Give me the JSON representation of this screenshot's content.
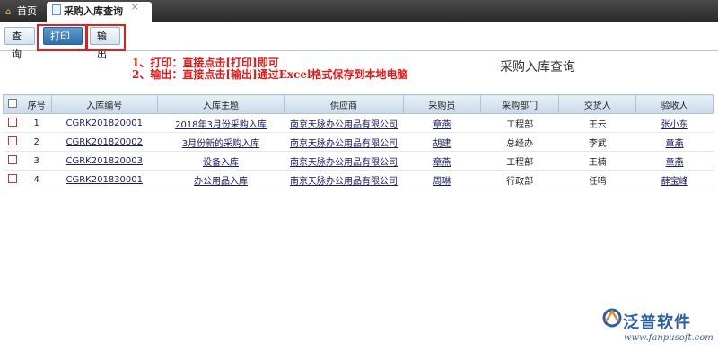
{
  "tabs": {
    "home_label": "首页",
    "active_label": "采购入库查询",
    "close_glyph": "×"
  },
  "toolbar": {
    "query_label": "查询",
    "print_label": "打印",
    "output_label": "输出"
  },
  "notes": {
    "line1": "1、打印：直接点击[打印]即可",
    "line2": "2、输出：直接点击[输出]通过Excel格式保存到本地电脑"
  },
  "page_title": "采购入库查询",
  "table": {
    "headers": [
      "",
      "序号",
      "入库编号",
      "入库主题",
      "供应商",
      "采购员",
      "采购部门",
      "交货人",
      "验收人"
    ],
    "rows": [
      [
        "1",
        "CGRK201820001",
        "2018年3月份采购入库",
        "南京天脉办公用品有限公司",
        "章燕",
        "工程部",
        "王云",
        "张小东"
      ],
      [
        "2",
        "CGRK201820002",
        "3月份新的采购入库",
        "南京天脉办公用品有限公司",
        "胡建",
        "总经办",
        "李武",
        "章燕"
      ],
      [
        "3",
        "CGRK201820003",
        "设备入库",
        "南京天脉办公用品有限公司",
        "章燕",
        "工程部",
        "王楠",
        "章燕"
      ],
      [
        "4",
        "CGRK201830001",
        "办公用品入库",
        "南京天脉办公用品有限公司",
        "周琳",
        "行政部",
        "任鸣",
        "薛宝峰"
      ]
    ]
  },
  "logo": {
    "name": "泛普软件",
    "url": "www.fanpusoft.com"
  },
  "colors": {
    "highlight": "#e02020",
    "note_text": "#e01818",
    "brand": "#2c5fa6"
  }
}
